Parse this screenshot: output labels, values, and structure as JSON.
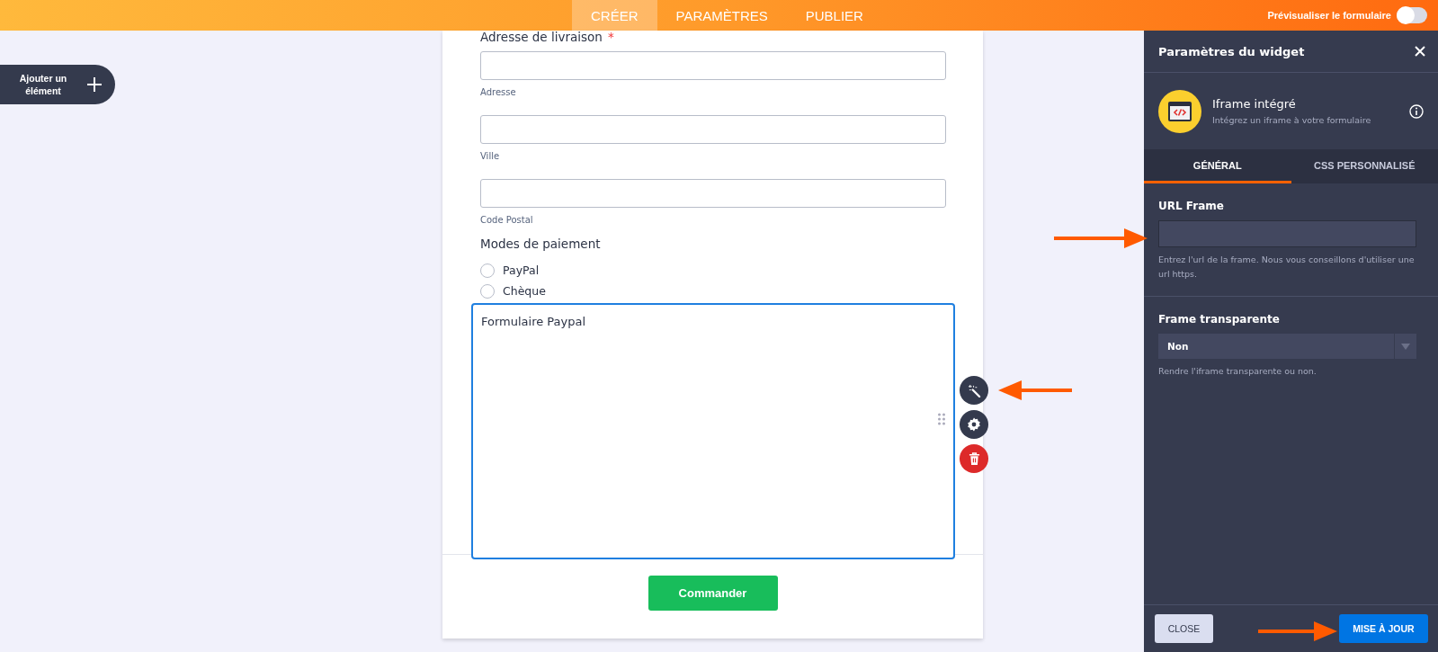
{
  "topbar": {
    "tabs": [
      {
        "label": "CRÉER",
        "selected": true
      },
      {
        "label": "PARAMÈTRES",
        "selected": false
      },
      {
        "label": "PUBLIER",
        "selected": false
      }
    ],
    "preview": {
      "label": "Prévisualiser le formulaire",
      "on": false
    }
  },
  "add_element": {
    "label": "Ajouter un élément"
  },
  "form": {
    "address": {
      "label": "Adresse de livraison",
      "required_mark": "*",
      "inputs": [
        {
          "sublabel": "Adresse"
        },
        {
          "sublabel": "Ville"
        },
        {
          "sublabel": "Code Postal"
        }
      ]
    },
    "payment": {
      "label": "Modes de paiement",
      "options": [
        {
          "label": "PayPal",
          "selected": false
        },
        {
          "label": "Chèque",
          "selected": false
        }
      ]
    },
    "selected_widget": {
      "text": "Formulaire Paypal"
    },
    "submit": "Commander"
  },
  "panel": {
    "title": "Paramètres du widget",
    "widget": {
      "name": "Iframe intégré",
      "description": "Intégrez un iframe à votre formulaire"
    },
    "tabs": [
      {
        "label": "GÉNÉRAL",
        "selected": true
      },
      {
        "label": "CSS PERSONNALISÉ",
        "selected": false
      }
    ],
    "fields": [
      {
        "kind": "text",
        "label": "URL Frame",
        "hint": "Entrez l'url de la frame. Nous vous conseillons d'utiliser une url https."
      },
      {
        "kind": "select",
        "label": "Frame transparente",
        "value": "Non",
        "hint": "Rendre l'iframe transparente ou non."
      }
    ],
    "buttons": [
      {
        "kind": "secondary",
        "label": "CLOSE"
      },
      {
        "kind": "primary",
        "label": "MISE À JOUR"
      }
    ]
  }
}
